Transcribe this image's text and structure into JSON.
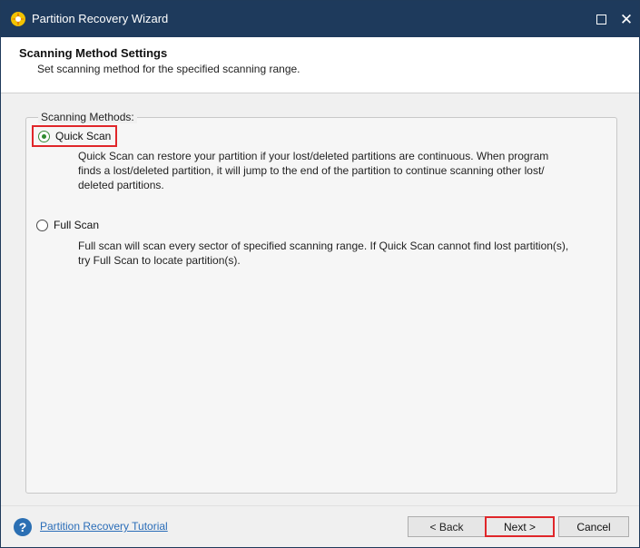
{
  "window": {
    "title": "Partition Recovery Wizard",
    "app_icon": "partition-wizard-logo-icon",
    "maximize_icon": "maximize-icon",
    "close_icon": "close-icon",
    "close_glyph": "✕"
  },
  "header": {
    "title": "Scanning Method Settings",
    "subtitle": "Set scanning method for the specified scanning range."
  },
  "group": {
    "legend": "Scanning Methods:"
  },
  "options": {
    "quick": {
      "label": "Quick Scan",
      "checked": true,
      "description_lines": [
        "Quick Scan can restore your partition if your lost/deleted partitions are continuous. When program",
        "finds a lost/deleted partition, it will jump to the end of the partition to continue scanning other lost/",
        "deleted partitions."
      ]
    },
    "full": {
      "label": "Full Scan",
      "checked": false,
      "description_lines": [
        "Full scan will scan every sector of specified scanning range. If Quick Scan cannot find lost partition(s),",
        "try Full Scan to locate partition(s)."
      ]
    }
  },
  "footer": {
    "help_icon": "help-icon",
    "help_glyph": "?",
    "tutorial_link": "Partition Recovery Tutorial",
    "back_label": "< Back",
    "next_label": "Next >",
    "cancel_label": "Cancel"
  },
  "colors": {
    "titlebar": "#1e3a5c",
    "highlight_border": "#e0262a",
    "radio_checked": "#2e8b2e",
    "link": "#2a6db8"
  }
}
